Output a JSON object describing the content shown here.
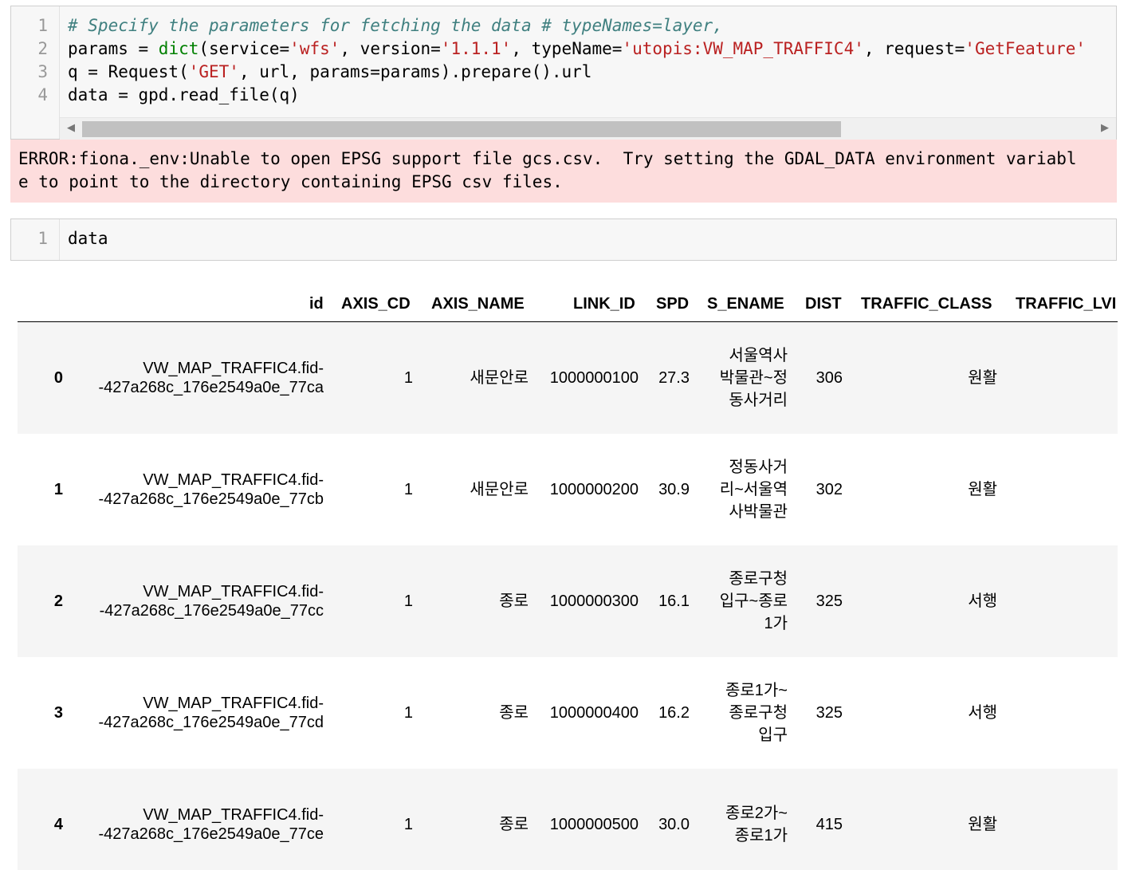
{
  "cell1": {
    "line_numbers": [
      "1",
      "2",
      "3",
      "4"
    ],
    "line1": {
      "comment": "# Specify the parameters for fetching the data # typeNames=layer,"
    },
    "line2": {
      "p1": "params = ",
      "builtin": "dict",
      "p2": "(service=",
      "s1": "'wfs'",
      "p3": ", version=",
      "s2": "'1.1.1'",
      "p4": ", typeName=",
      "s3": "'utopis:VW_MAP_TRAFFIC4'",
      "p5": ", request=",
      "s4": "'GetFeature'"
    },
    "line3": {
      "p1": "q = Request(",
      "s1": "'GET'",
      "p2": ", url, params=params).prepare().url"
    },
    "line4": {
      "p1": "data = gpd.read_file(q)"
    }
  },
  "error": {
    "text": "ERROR:fiona._env:Unable to open EPSG support file gcs.csv.  Try setting the GDAL_DATA environment variabl\ne to point to the directory containing EPSG csv files."
  },
  "cell2": {
    "line_number": "1",
    "code": "data"
  },
  "table": {
    "columns": [
      "id",
      "AXIS_CD",
      "AXIS_NAME",
      "LINK_ID",
      "SPD",
      "S_ENAME",
      "DIST",
      "TRAFFIC_CLASS",
      "TRAFFIC_LVI"
    ],
    "rows": [
      {
        "index": "0",
        "id1": "VW_MAP_TRAFFIC4.fid-",
        "id2": "-427a268c_176e2549a0e_77ca",
        "axis_cd": "1",
        "axis_name": "새문안로",
        "link_id": "1000000100",
        "spd": "27.3",
        "s_ename": [
          "서울역사",
          "박물관~정",
          "동사거리"
        ],
        "dist": "306",
        "traffic_class": "원활"
      },
      {
        "index": "1",
        "id1": "VW_MAP_TRAFFIC4.fid-",
        "id2": "-427a268c_176e2549a0e_77cb",
        "axis_cd": "1",
        "axis_name": "새문안로",
        "link_id": "1000000200",
        "spd": "30.9",
        "s_ename": [
          "정동사거",
          "리~서울역",
          "사박물관"
        ],
        "dist": "302",
        "traffic_class": "원활"
      },
      {
        "index": "2",
        "id1": "VW_MAP_TRAFFIC4.fid-",
        "id2": "-427a268c_176e2549a0e_77cc",
        "axis_cd": "1",
        "axis_name": "종로",
        "link_id": "1000000300",
        "spd": "16.1",
        "s_ename": [
          "종로구청",
          "입구~종로",
          "1가"
        ],
        "dist": "325",
        "traffic_class": "서행"
      },
      {
        "index": "3",
        "id1": "VW_MAP_TRAFFIC4.fid-",
        "id2": "-427a268c_176e2549a0e_77cd",
        "axis_cd": "1",
        "axis_name": "종로",
        "link_id": "1000000400",
        "spd": "16.2",
        "s_ename": [
          "종로1가~",
          "종로구청",
          "입구"
        ],
        "dist": "325",
        "traffic_class": "서행"
      },
      {
        "index": "4",
        "id1": "VW_MAP_TRAFFIC4.fid-",
        "id2": "-427a268c_176e2549a0e_77ce",
        "axis_cd": "1",
        "axis_name": "종로",
        "link_id": "1000000500",
        "spd": "30.0",
        "s_ename": [
          "종로2가~",
          "종로1가"
        ],
        "dist": "415",
        "traffic_class": "원활"
      }
    ]
  }
}
